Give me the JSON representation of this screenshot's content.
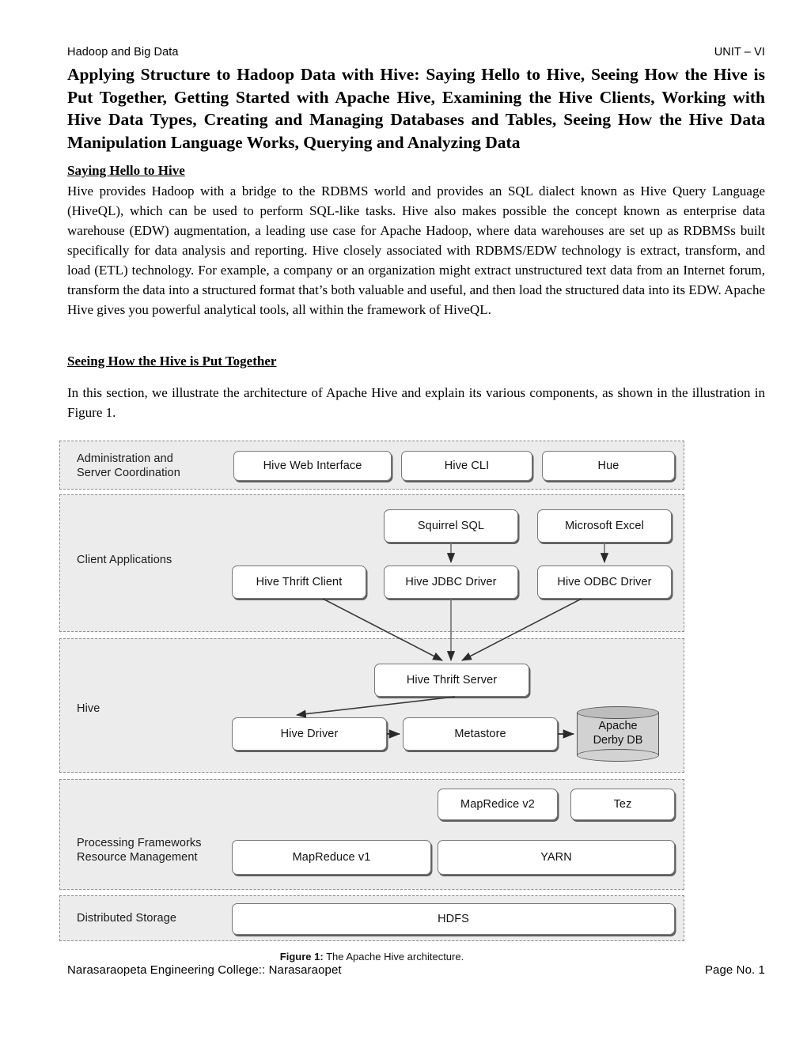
{
  "header": {
    "left": "Hadoop and Big Data",
    "right": "UNIT – VI"
  },
  "title": "Applying Structure to Hadoop Data with Hive: Saying Hello to Hive, Seeing How the Hive is Put Together, Getting Started with Apache Hive, Examining the Hive Clients, Working with Hive Data Types, Creating and Managing Databases and Tables, Seeing How the Hive Data Manipulation Language Works, Querying and Analyzing Data",
  "sections": [
    {
      "heading": "Saying Hello to Hive",
      "body": "Hive provides Hadoop with a bridge to the RDBMS world and provides an SQL dialect known as Hive Query Language (HiveQL), which can be used to perform SQL-like tasks. Hive also makes possible the concept known as enterprise data warehouse (EDW) augmentation, a leading use case for Apache Hadoop, where data warehouses are set up as RDBMSs built specifically for data analysis and reporting. Hive closely associated with RDBMS/EDW technology is extract, transform, and load (ETL) technology. For example, a company or an organization might extract unstructured text data from an Internet forum, transform the data into a structured format that’s both valuable and useful, and then load the structured data into its EDW. Apache Hive gives you powerful analytical tools, all within the framework of HiveQL."
    },
    {
      "heading": "Seeing How the Hive is Put Together",
      "body": "In this section, we illustrate the architecture of Apache Hive and  explain its various components, as shown in the illustration in Figure 1."
    }
  ],
  "figure": {
    "caption_label": "Figure 1:",
    "caption_text": " The Apache Hive architecture.",
    "bands": [
      {
        "label": "Administration and\nServer Coordination"
      },
      {
        "label": "Client Applications"
      },
      {
        "label": "Hive"
      },
      {
        "label": "Processing Frameworks\nResource Management"
      },
      {
        "label": "Distributed Storage"
      }
    ],
    "nodes": {
      "hive_web_interface": "Hive Web Interface",
      "hive_cli": "Hive CLI",
      "hue": "Hue",
      "squirrel_sql": "Squirrel SQL",
      "microsoft_excel": "Microsoft Excel",
      "hive_thrift_client": "Hive Thrift Client",
      "hive_jdbc_driver": "Hive JDBC Driver",
      "hive_odbc_driver": "Hive ODBC Driver",
      "hive_thrift_server": "Hive Thrift Server",
      "hive_driver": "Hive Driver",
      "metastore": "Metastore",
      "apache_derby_db": "Apache\nDerby DB",
      "mapredice_v2": "MapRedice v2",
      "tez": "Tez",
      "mapreduce_v1": "MapReduce v1",
      "yarn": "YARN",
      "hdfs": "HDFS"
    }
  },
  "footer": {
    "left": "Narasaraopeta Engineering College:: Narasaraopet",
    "right": "Page No. 1"
  }
}
